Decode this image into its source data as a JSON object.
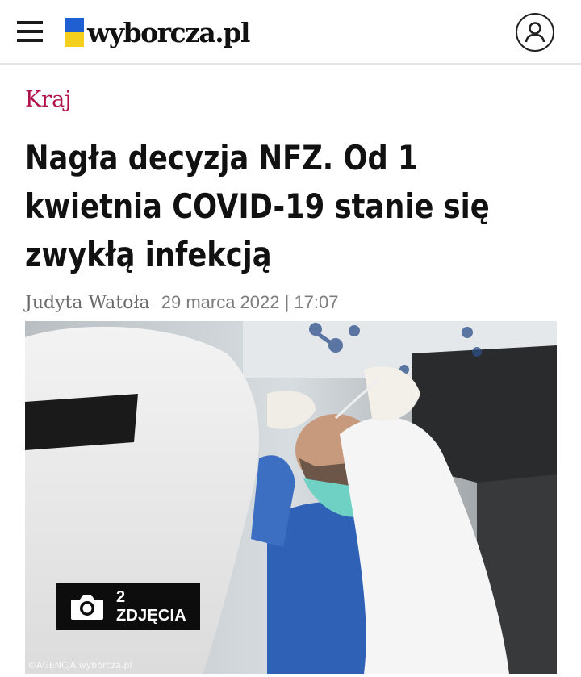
{
  "header": {
    "menu_icon": "hamburger-menu-icon",
    "logo_text": "wyborcza.pl",
    "flag_colors": [
      "#1f5fd1",
      "#f4cf1d"
    ],
    "user_icon": "user-account-icon"
  },
  "article": {
    "section": "Kraj",
    "section_color": "#b2124c",
    "title": "Nagła decyzja NFZ. Od 1 kwietnia COVID-19 stanie się zwykłą infekcją",
    "author": "Judyta Watoła",
    "date": "29 marca 2022 | 17:07",
    "photo": {
      "badge_icon": "camera-icon",
      "badge_label": "2 ZDJĘCIA",
      "credit": "©AGENCJA wyborcza.pl"
    }
  }
}
